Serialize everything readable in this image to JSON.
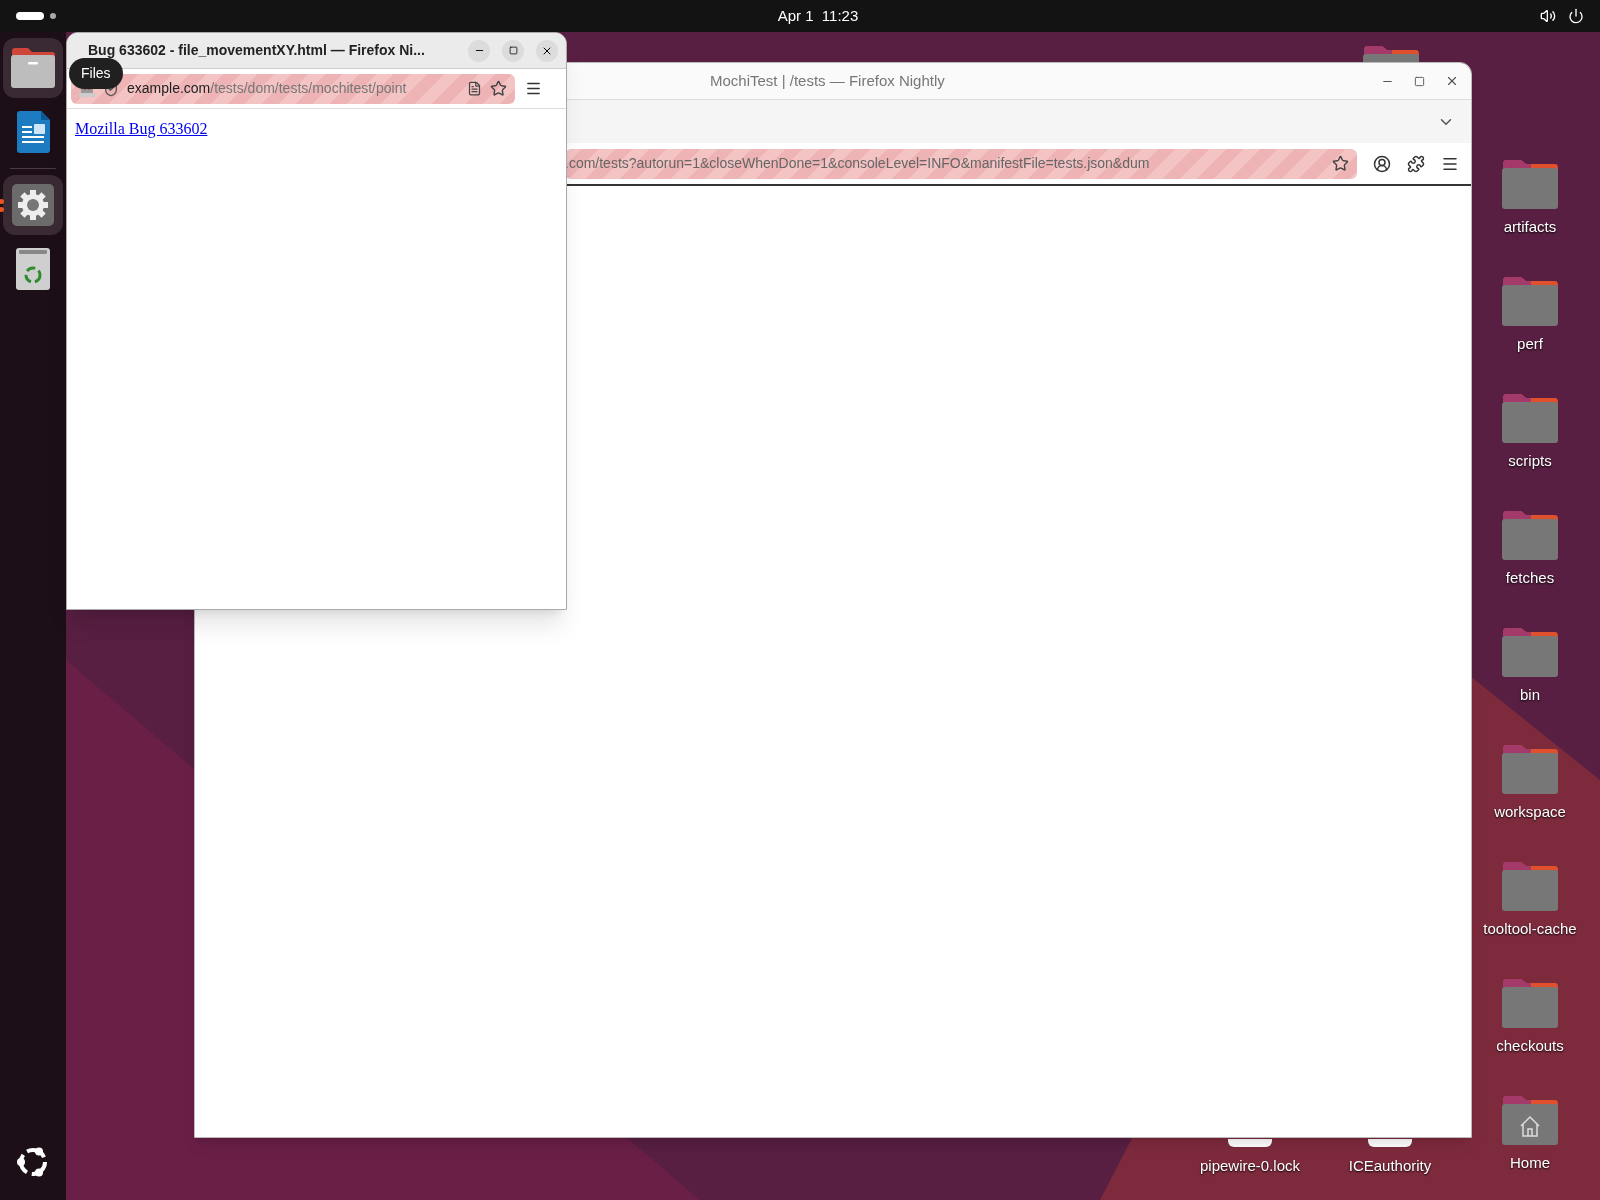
{
  "top_bar": {
    "clock": "Apr 1  11:23"
  },
  "dock": {
    "items": [
      {
        "kind": "files",
        "selected": true,
        "running": false,
        "tooltip": "Files"
      },
      {
        "kind": "writer",
        "selected": false,
        "running": false
      },
      {
        "kind": "separator"
      },
      {
        "kind": "settings",
        "selected": true,
        "running": true
      },
      {
        "kind": "trash",
        "selected": false,
        "running": false
      }
    ]
  },
  "desktop_icons": [
    {
      "kind": "folder",
      "name": "artifacts"
    },
    {
      "kind": "folder",
      "name": "perf"
    },
    {
      "kind": "folder",
      "name": "scripts"
    },
    {
      "kind": "folder",
      "name": "fetches"
    },
    {
      "kind": "folder",
      "name": "bin"
    },
    {
      "kind": "folder",
      "name": "workspace"
    },
    {
      "kind": "folder",
      "name": "tooltool-cache"
    },
    {
      "kind": "folder",
      "name": "checkouts"
    },
    {
      "kind": "home",
      "name": "Home"
    }
  ],
  "bottom_icons": [
    {
      "kind": "file",
      "name": "pipewire-0.lock"
    },
    {
      "kind": "file",
      "name": "ICEauthority"
    }
  ],
  "back_window": {
    "title": "MochiTest | /tests — Firefox Nightly",
    "url": ".com/tests?autorun=1&closeWhenDone=1&consoleLevel=INFO&manifestFile=tests.json&dum"
  },
  "front_window": {
    "title": "Bug 633602 - file_movementXY.html — Firefox Ni...",
    "url_domain": "example.com",
    "url_path": "/tests/dom/tests/mochitest/point",
    "link": "Mozilla Bug 633602"
  }
}
